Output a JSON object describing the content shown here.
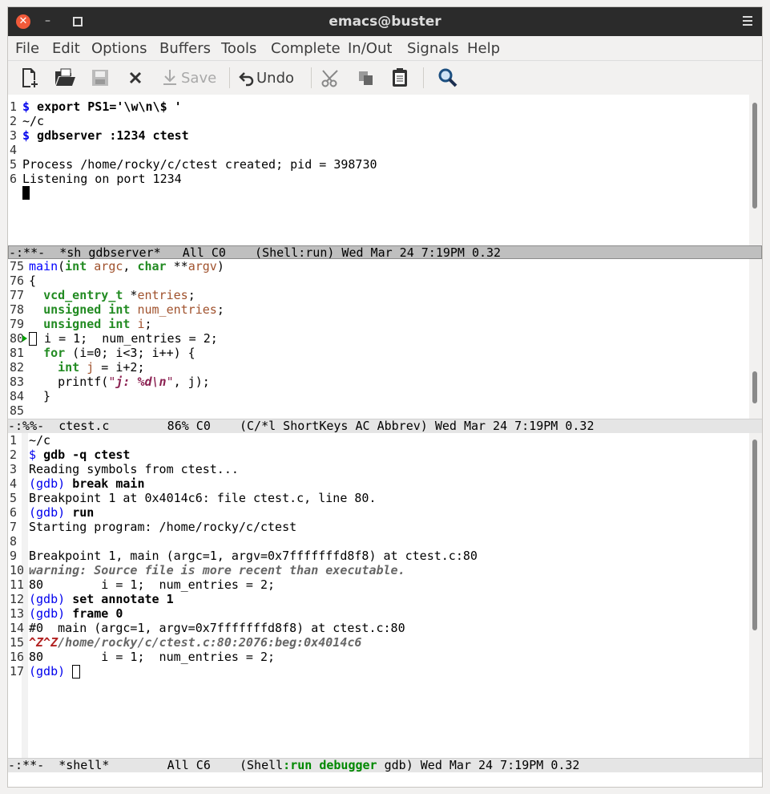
{
  "window": {
    "title": "emacs@buster"
  },
  "menu": [
    "File",
    "Edit",
    "Options",
    "Buffers",
    "Tools",
    "Complete",
    "In/Out",
    "Signals",
    "Help"
  ],
  "toolbar": {
    "save": "Save",
    "undo": "Undo"
  },
  "pane1": {
    "lines": [
      {
        "n": "1",
        "t": "$ export PS1='\\w\\n\\$ '"
      },
      {
        "n": "2",
        "t": "~/c"
      },
      {
        "n": "3",
        "t": "$ gdbserver :1234 ctest"
      },
      {
        "n": "4",
        "t": ""
      },
      {
        "n": "5",
        "t": "Process /home/rocky/c/ctest created; pid = 398730"
      },
      {
        "n": "6",
        "t": "Listening on port 1234"
      }
    ],
    "modeline": "-:**-  *sh gdbserver*   All C0    (Shell:run) Wed Mar 24 7:19PM 0.32"
  },
  "pane2": {
    "line_numbers": [
      "75",
      "76",
      "77",
      "78",
      "79",
      "80",
      "81",
      "82",
      "83",
      "84",
      "85"
    ],
    "modeline": "-:%%-  ctest.c        86% C0    (C/*l ShortKeys AC Abbrev) Wed Mar 24 7:19PM 0.32"
  },
  "pane3": {
    "line_numbers": [
      "1",
      "2",
      "3",
      "4",
      "5",
      "6",
      "7",
      "8",
      "9",
      "10",
      "11",
      "12",
      "13",
      "14",
      "15",
      "16",
      "17"
    ],
    "text": {
      "l1": "~/c",
      "l2_cmd": "gdb -q ctest",
      "l3": "Reading symbols from ctest...",
      "l4_cmd": "break main",
      "l5": "Breakpoint 1 at 0x4014c6: file ctest.c, line 80.",
      "l6_cmd": "run",
      "l7": "Starting program: /home/rocky/c/ctest",
      "l9": "Breakpoint 1, main (argc=1, argv=0x7fffffffd8f8) at ctest.c:80",
      "l10": "warning: Source file is more recent than executable.",
      "l11": "80        i = 1;  num_entries = 2;",
      "l12_cmd": "set annotate 1",
      "l13_cmd": "frame 0",
      "l14": "#0  main (argc=1, argv=0x7fffffffd8f8) at ctest.c:80",
      "l15_ctl": "^Z^Z",
      "l15_path": "/home/rocky/c/ctest.c:80:2076:beg:0x4014c6",
      "l16": "80        i = 1;  num_entries = 2;",
      "prompt": "(gdb)",
      "dollar": "$"
    },
    "modeline_pre": "-:**-  *shell*        All C6    (Shell",
    "modeline_run": ":run debugger",
    "modeline_post": " gdb) Wed Mar 24 7:19PM 0.32"
  }
}
